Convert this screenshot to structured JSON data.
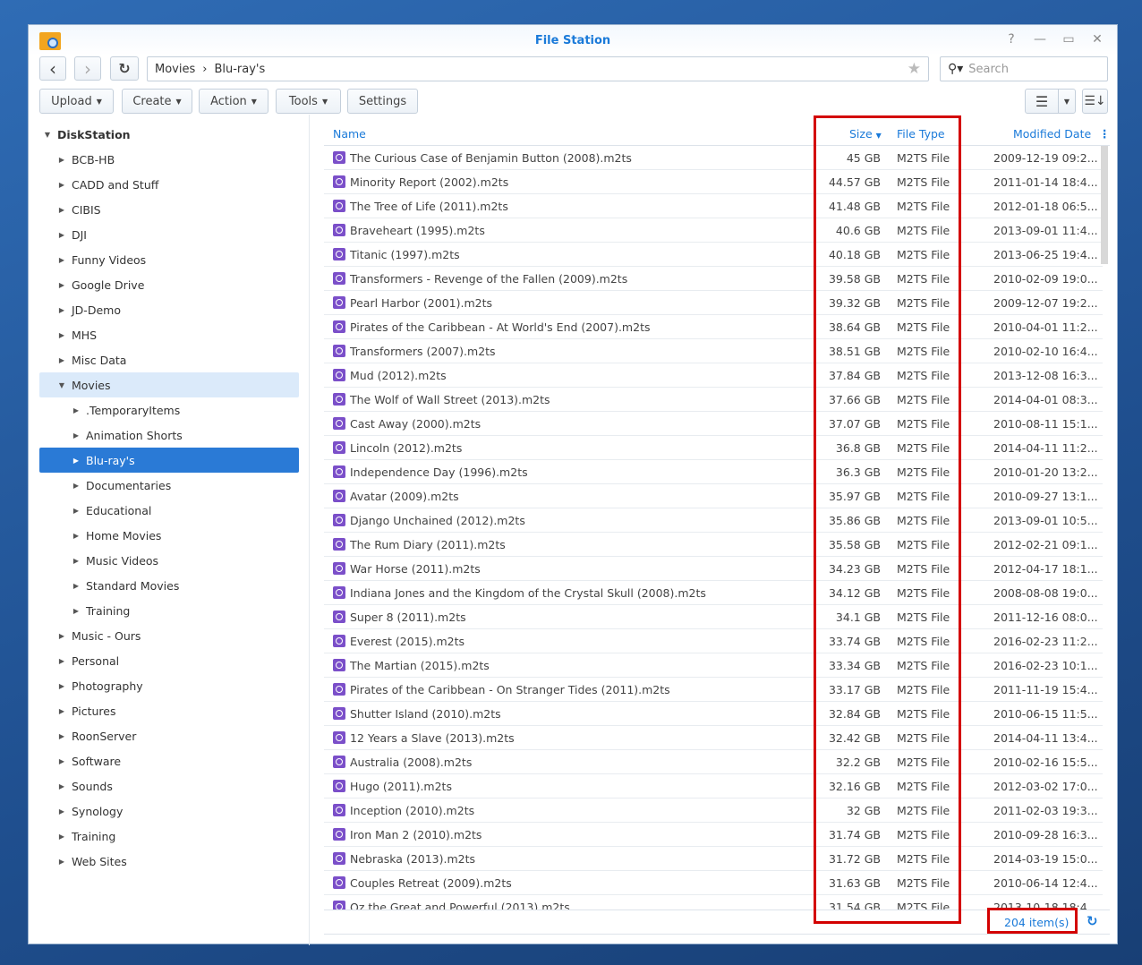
{
  "window": {
    "title": "File Station",
    "controls": [
      "?",
      "—",
      "▭",
      "✕"
    ]
  },
  "nav": {
    "back": "‹",
    "forward": "›",
    "refresh": "↻",
    "path": [
      "Movies",
      "Blu-ray's"
    ],
    "search_placeholder": "Search"
  },
  "toolbar": {
    "upload": "Upload",
    "create": "Create",
    "action": "Action",
    "tools": "Tools",
    "settings": "Settings"
  },
  "tree": [
    {
      "label": "DiskStation",
      "level": 0,
      "open": true
    },
    {
      "label": "BCB-HB",
      "level": 1
    },
    {
      "label": "CADD and Stuff",
      "level": 1
    },
    {
      "label": "CIBIS",
      "level": 1
    },
    {
      "label": "DJI",
      "level": 1
    },
    {
      "label": "Funny Videos",
      "level": 1
    },
    {
      "label": "Google Drive",
      "level": 1
    },
    {
      "label": "JD-Demo",
      "level": 1
    },
    {
      "label": "MHS",
      "level": 1
    },
    {
      "label": "Misc Data",
      "level": 1
    },
    {
      "label": "Movies",
      "level": 1,
      "open": true,
      "state": "highlight"
    },
    {
      "label": ".TemporaryItems",
      "level": 2
    },
    {
      "label": "Animation Shorts",
      "level": 2
    },
    {
      "label": "Blu-ray's",
      "level": 2,
      "state": "selected"
    },
    {
      "label": "Documentaries",
      "level": 2
    },
    {
      "label": "Educational",
      "level": 2
    },
    {
      "label": "Home Movies",
      "level": 2
    },
    {
      "label": "Music Videos",
      "level": 2
    },
    {
      "label": "Standard Movies",
      "level": 2
    },
    {
      "label": "Training",
      "level": 2
    },
    {
      "label": "Music - Ours",
      "level": 1
    },
    {
      "label": "Personal",
      "level": 1
    },
    {
      "label": "Photography",
      "level": 1
    },
    {
      "label": "Pictures",
      "level": 1
    },
    {
      "label": "RoonServer",
      "level": 1
    },
    {
      "label": "Software",
      "level": 1
    },
    {
      "label": "Sounds",
      "level": 1
    },
    {
      "label": "Synology",
      "level": 1
    },
    {
      "label": "Training",
      "level": 1
    },
    {
      "label": "Web Sites",
      "level": 1
    }
  ],
  "columns": {
    "name": "Name",
    "size": "Size",
    "type": "File Type",
    "date": "Modified Date"
  },
  "files": [
    [
      "The Curious Case of Benjamin Button (2008).m2ts",
      "45 GB",
      "M2TS File",
      "2009-12-19 09:2..."
    ],
    [
      "Minority Report (2002).m2ts",
      "44.57 GB",
      "M2TS File",
      "2011-01-14 18:4..."
    ],
    [
      "The Tree of Life (2011).m2ts",
      "41.48 GB",
      "M2TS File",
      "2012-01-18 06:5..."
    ],
    [
      "Braveheart (1995).m2ts",
      "40.6 GB",
      "M2TS File",
      "2013-09-01 11:4..."
    ],
    [
      "Titanic (1997).m2ts",
      "40.18 GB",
      "M2TS File",
      "2013-06-25 19:4..."
    ],
    [
      "Transformers - Revenge of the Fallen (2009).m2ts",
      "39.58 GB",
      "M2TS File",
      "2010-02-09 19:0..."
    ],
    [
      "Pearl Harbor (2001).m2ts",
      "39.32 GB",
      "M2TS File",
      "2009-12-07 19:2..."
    ],
    [
      "Pirates of the Caribbean - At World's End (2007).m2ts",
      "38.64 GB",
      "M2TS File",
      "2010-04-01 11:2..."
    ],
    [
      "Transformers (2007).m2ts",
      "38.51 GB",
      "M2TS File",
      "2010-02-10 16:4..."
    ],
    [
      "Mud (2012).m2ts",
      "37.84 GB",
      "M2TS File",
      "2013-12-08 16:3..."
    ],
    [
      "The Wolf of Wall Street (2013).m2ts",
      "37.66 GB",
      "M2TS File",
      "2014-04-01 08:3..."
    ],
    [
      "Cast Away (2000).m2ts",
      "37.07 GB",
      "M2TS File",
      "2010-08-11 15:1..."
    ],
    [
      "Lincoln (2012).m2ts",
      "36.8 GB",
      "M2TS File",
      "2014-04-11 11:2..."
    ],
    [
      "Independence Day (1996).m2ts",
      "36.3 GB",
      "M2TS File",
      "2010-01-20 13:2..."
    ],
    [
      "Avatar (2009).m2ts",
      "35.97 GB",
      "M2TS File",
      "2010-09-27 13:1..."
    ],
    [
      "Django Unchained (2012).m2ts",
      "35.86 GB",
      "M2TS File",
      "2013-09-01 10:5..."
    ],
    [
      "The Rum Diary (2011).m2ts",
      "35.58 GB",
      "M2TS File",
      "2012-02-21 09:1..."
    ],
    [
      "War Horse (2011).m2ts",
      "34.23 GB",
      "M2TS File",
      "2012-04-17 18:1..."
    ],
    [
      "Indiana Jones and the Kingdom of the Crystal Skull (2008).m2ts",
      "34.12 GB",
      "M2TS File",
      "2008-08-08 19:0..."
    ],
    [
      "Super 8 (2011).m2ts",
      "34.1 GB",
      "M2TS File",
      "2011-12-16 08:0..."
    ],
    [
      "Everest (2015).m2ts",
      "33.74 GB",
      "M2TS File",
      "2016-02-23 11:2..."
    ],
    [
      "The Martian (2015).m2ts",
      "33.34 GB",
      "M2TS File",
      "2016-02-23 10:1..."
    ],
    [
      "Pirates of the Caribbean - On Stranger Tides (2011).m2ts",
      "33.17 GB",
      "M2TS File",
      "2011-11-19 15:4..."
    ],
    [
      "Shutter Island (2010).m2ts",
      "32.84 GB",
      "M2TS File",
      "2010-06-15 11:5..."
    ],
    [
      "12 Years a Slave (2013).m2ts",
      "32.42 GB",
      "M2TS File",
      "2014-04-11 13:4..."
    ],
    [
      "Australia (2008).m2ts",
      "32.2 GB",
      "M2TS File",
      "2010-02-16 15:5..."
    ],
    [
      "Hugo (2011).m2ts",
      "32.16 GB",
      "M2TS File",
      "2012-03-02 17:0..."
    ],
    [
      "Inception (2010).m2ts",
      "32 GB",
      "M2TS File",
      "2011-02-03 19:3..."
    ],
    [
      "Iron Man 2 (2010).m2ts",
      "31.74 GB",
      "M2TS File",
      "2010-09-28 16:3..."
    ],
    [
      "Nebraska (2013).m2ts",
      "31.72 GB",
      "M2TS File",
      "2014-03-19 15:0..."
    ],
    [
      "Couples Retreat (2009).m2ts",
      "31.63 GB",
      "M2TS File",
      "2010-06-14 12:4..."
    ],
    [
      "Oz the Great and Powerful (2013).m2ts",
      "31.54 GB",
      "M2TS File",
      "2013-10-18 18:4..."
    ]
  ],
  "footer": {
    "count": "204 item(s)"
  },
  "colors": {
    "accent": "#1a7ad9",
    "selected": "#2a7ad6",
    "highlight_box": "#d30000",
    "file_icon": "#7b4fc9"
  }
}
